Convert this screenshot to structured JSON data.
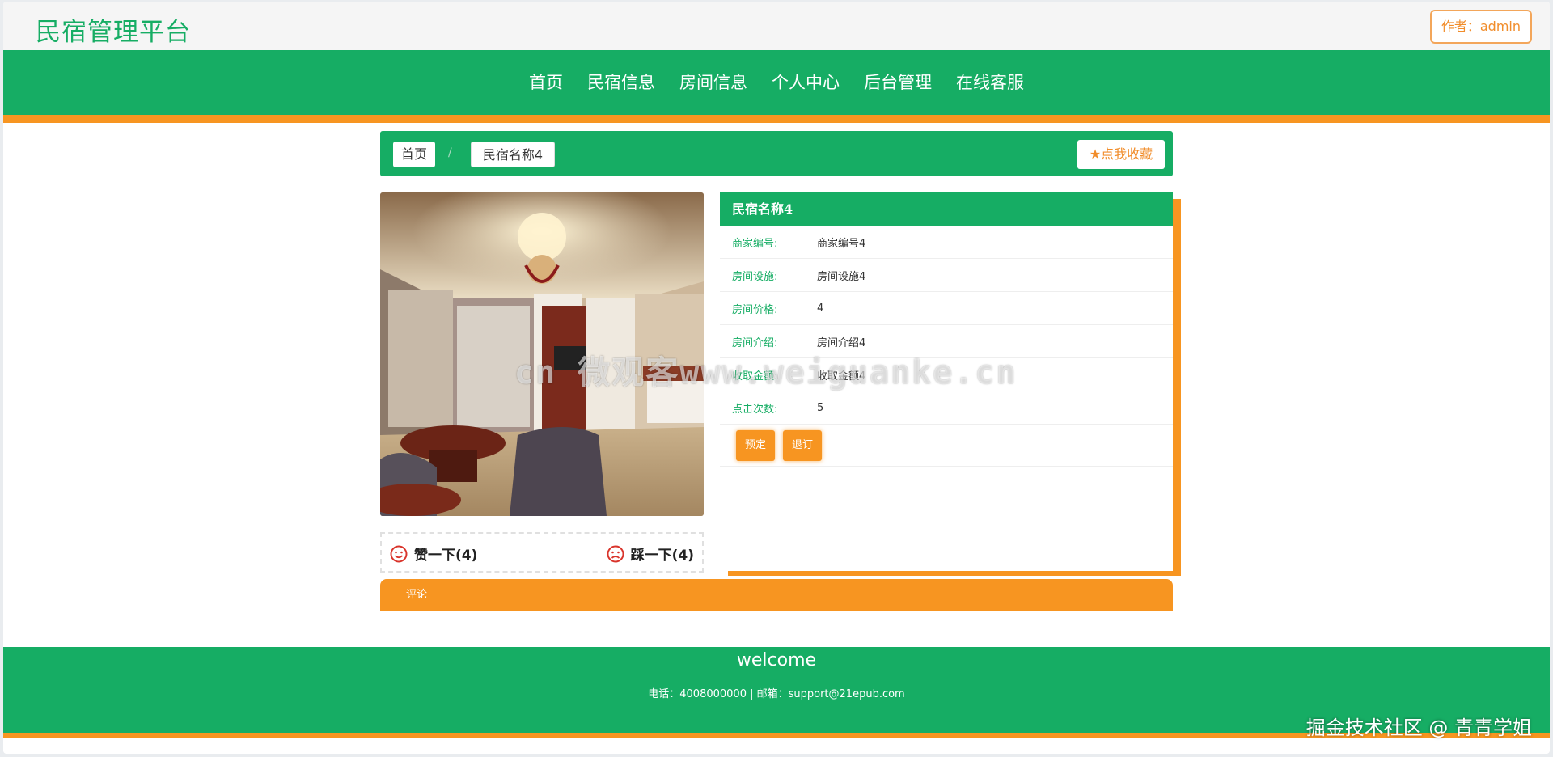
{
  "header": {
    "site_title": "民宿管理平台",
    "author_label": "作者：admin"
  },
  "nav": {
    "items": [
      "首页",
      "民宿信息",
      "房间信息",
      "个人中心",
      "后台管理",
      "在线客服"
    ]
  },
  "breadcrumb": {
    "home": "首页",
    "separator": "/",
    "current": "民宿名称4",
    "favorite_label": "点我收藏"
  },
  "detail": {
    "title": "民宿名称4",
    "fields": [
      {
        "label": "商家编号:",
        "value": "商家编号4"
      },
      {
        "label": "房间设施:",
        "value": "房间设施4"
      },
      {
        "label": "房间价格:",
        "value": "4"
      },
      {
        "label": "房间介绍:",
        "value": "房间介绍4"
      },
      {
        "label": "收取金额:",
        "value": "收取金额4"
      },
      {
        "label": "点击次数:",
        "value": "5"
      }
    ],
    "book_button": "预定",
    "checkout_button": "退订"
  },
  "votes": {
    "like": "赞一下(4)",
    "dislike": "踩一下(4)"
  },
  "comment": {
    "title": "评论"
  },
  "footer": {
    "welcome": "welcome",
    "contact": "电话：4008000000 | 邮箱：support@21epub.com"
  },
  "overlays": {
    "watermark": "cn 微观客www.weiguanke.cn",
    "corner": "掘金技术社区 @ 青青学姐"
  },
  "colors": {
    "green": "#16ad64",
    "orange": "#f79521"
  }
}
